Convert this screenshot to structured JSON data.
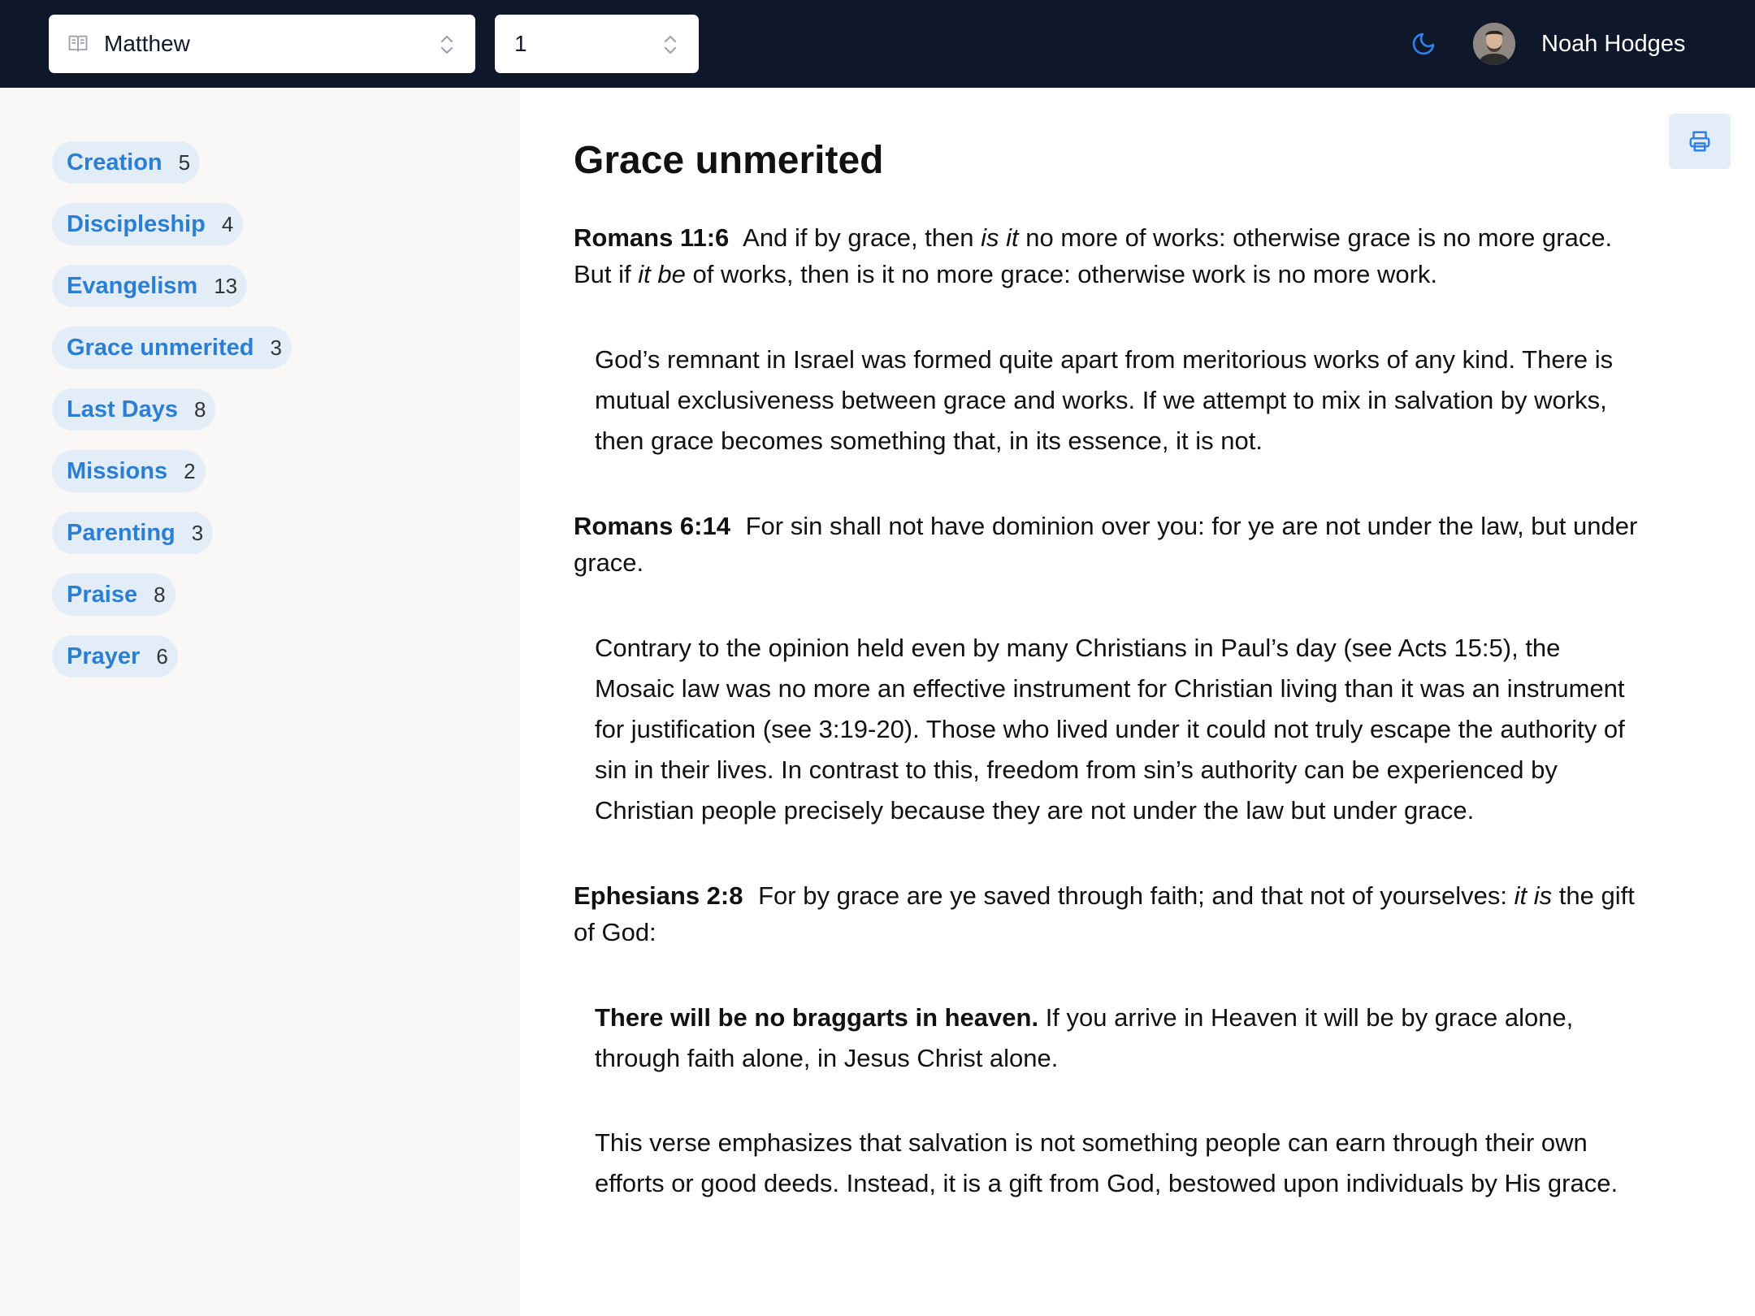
{
  "header": {
    "book_select": {
      "value": "Matthew",
      "icon": "book-icon"
    },
    "chapter_select": {
      "value": "1"
    },
    "theme_toggle_icon": "moon-icon",
    "user": {
      "name": "Noah Hodges"
    }
  },
  "sidebar": {
    "tags": [
      {
        "label": "Creation",
        "count": "5"
      },
      {
        "label": "Discipleship",
        "count": "4"
      },
      {
        "label": "Evangelism",
        "count": "13"
      },
      {
        "label": "Grace unmerited",
        "count": "3"
      },
      {
        "label": "Last Days",
        "count": "8"
      },
      {
        "label": "Missions",
        "count": "2"
      },
      {
        "label": "Parenting",
        "count": "3"
      },
      {
        "label": "Praise",
        "count": "8"
      },
      {
        "label": "Prayer",
        "count": "6"
      }
    ]
  },
  "main": {
    "print_icon": "printer-icon",
    "title": "Grace unmerited",
    "entries": [
      {
        "ref": "Romans 11:6",
        "verse": {
          "t1": "And if by grace, then ",
          "i1": "is it",
          "t2": " no more of works: otherwise grace is no more grace. But if ",
          "i2": "it be",
          "t3": " of works, then is it no more grace: otherwise work is no more work."
        },
        "note": "God’s remnant in Israel was formed quite apart from meritorious works of any kind. There is mutual exclusiveness between grace and works. If we attempt to mix in salvation by works, then grace becomes something that, in its essence, it is not."
      },
      {
        "ref": "Romans 6:14",
        "verse": {
          "t1": "For sin shall not have dominion over you: for ye are not under the law, but under grace."
        },
        "note": "Contrary to the opinion held even by many Christians in Paul’s day (see Acts 15:5), the Mosaic law was no more an effective instrument for Christian living than it was an instrument for justification (see 3:19-20). Those who lived under it could not truly escape the authority of sin in their lives. In contrast to this, freedom from sin’s authority can be experienced by Christian people precisely because they are not under the law but under grace."
      },
      {
        "ref": "Ephesians 2:8",
        "verse": {
          "t1": "For by grace are ye saved through faith; and that not of yourselves: ",
          "i1": "it is",
          "t2": " the gift of God:"
        },
        "note_bold": "There will be no braggarts in heaven.",
        "note": " If you arrive in Heaven it will be by grace alone, through faith alone, in Jesus Christ alone.",
        "note2": "This verse emphasizes that salvation is not something people can earn through their own efforts or good deeds. Instead, it is a gift from God, bestowed upon individuals by His grace."
      }
    ]
  }
}
